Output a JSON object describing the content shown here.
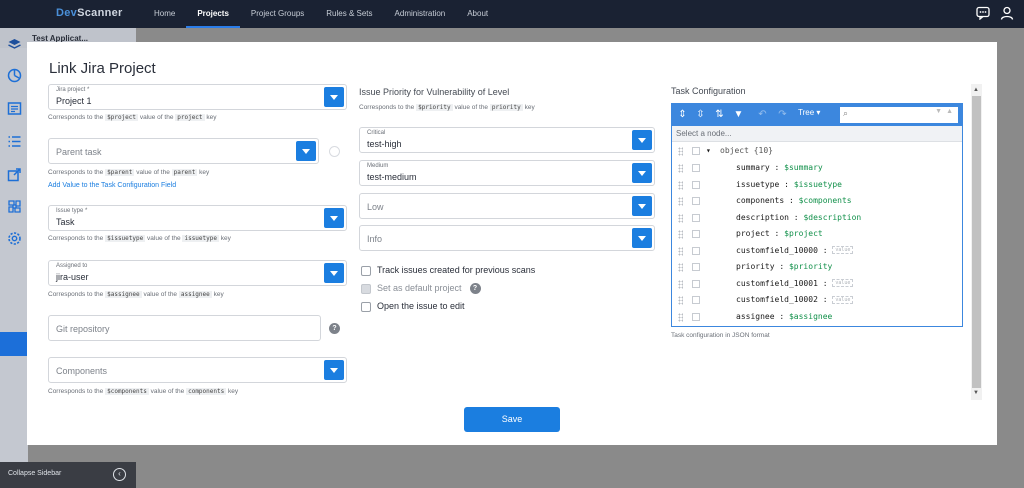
{
  "app": {
    "logo_a": "Dev",
    "logo_b": "Scanner"
  },
  "nav": [
    "Home",
    "Projects",
    "Project Groups",
    "Rules & Sets",
    "Administration",
    "About"
  ],
  "sidebar": {
    "title": "Test Applicat...",
    "collapse_label": "Collapse Sidebar"
  },
  "modal": {
    "title": "Link Jira Project",
    "jira_project": {
      "label": "Jira project *",
      "value": "Project 1",
      "hint_a": "Corresponds to the",
      "hint_var": "$project",
      "hint_b": "value of the",
      "hint_key": "project",
      "hint_c": "key"
    },
    "parent_task": {
      "placeholder": "Parent task",
      "hint_a": "Corresponds to the",
      "hint_var": "$parent",
      "hint_b": "value of the",
      "hint_key": "parent",
      "hint_c": "key"
    },
    "add_value_link": "Add Value to the Task Configuration Field",
    "issue_type": {
      "label": "Issue type *",
      "value": "Task",
      "hint_a": "Corresponds to the",
      "hint_var": "$issuetype",
      "hint_b": "value of the",
      "hint_key": "issuetype",
      "hint_c": "key"
    },
    "assigned_to": {
      "label": "Assigned to",
      "value": "jira-user",
      "hint_a": "Corresponds to the",
      "hint_var": "$assignee",
      "hint_b": "value of the",
      "hint_key": "assignee",
      "hint_c": "key"
    },
    "git_repo": {
      "placeholder": "Git repository"
    },
    "components": {
      "placeholder": "Components",
      "hint_a": "Corresponds to the",
      "hint_var": "$components",
      "hint_b": "value of the",
      "hint_key": "components",
      "hint_c": "key"
    },
    "priority_section": {
      "title": "Issue Priority for Vulnerability of Level",
      "hint_a": "Corresponds to the",
      "hint_var": "$priority",
      "hint_b": "value of the",
      "hint_key": "priority",
      "hint_c": "key"
    },
    "critical": {
      "label": "Critical",
      "value": "test-high"
    },
    "medium": {
      "label": "Medium",
      "value": "test-medium"
    },
    "low": {
      "placeholder": "Low"
    },
    "info": {
      "placeholder": "Info"
    },
    "checkboxes": {
      "track": "Track issues created for previous scans",
      "default": "Set as default project",
      "open": "Open the issue to edit"
    },
    "task_config": {
      "title": "Task Configuration",
      "tree_label": "Tree",
      "select_node": "Select a node...",
      "root": "object {10}",
      "rows": [
        {
          "key": "summary",
          "value": "$summary"
        },
        {
          "key": "issuetype",
          "value": "$issuetype"
        },
        {
          "key": "components",
          "value": "$components"
        },
        {
          "key": "description",
          "value": "$description"
        },
        {
          "key": "project",
          "value": "$project"
        },
        {
          "key": "customfield_10000",
          "value": ""
        },
        {
          "key": "priority",
          "value": "$priority"
        },
        {
          "key": "customfield_10001",
          "value": ""
        },
        {
          "key": "customfield_10002",
          "value": ""
        },
        {
          "key": "assignee",
          "value": "$assignee"
        }
      ],
      "empty_placeholder": "value",
      "footer": "Task configuration in JSON format"
    },
    "save": "Save"
  }
}
